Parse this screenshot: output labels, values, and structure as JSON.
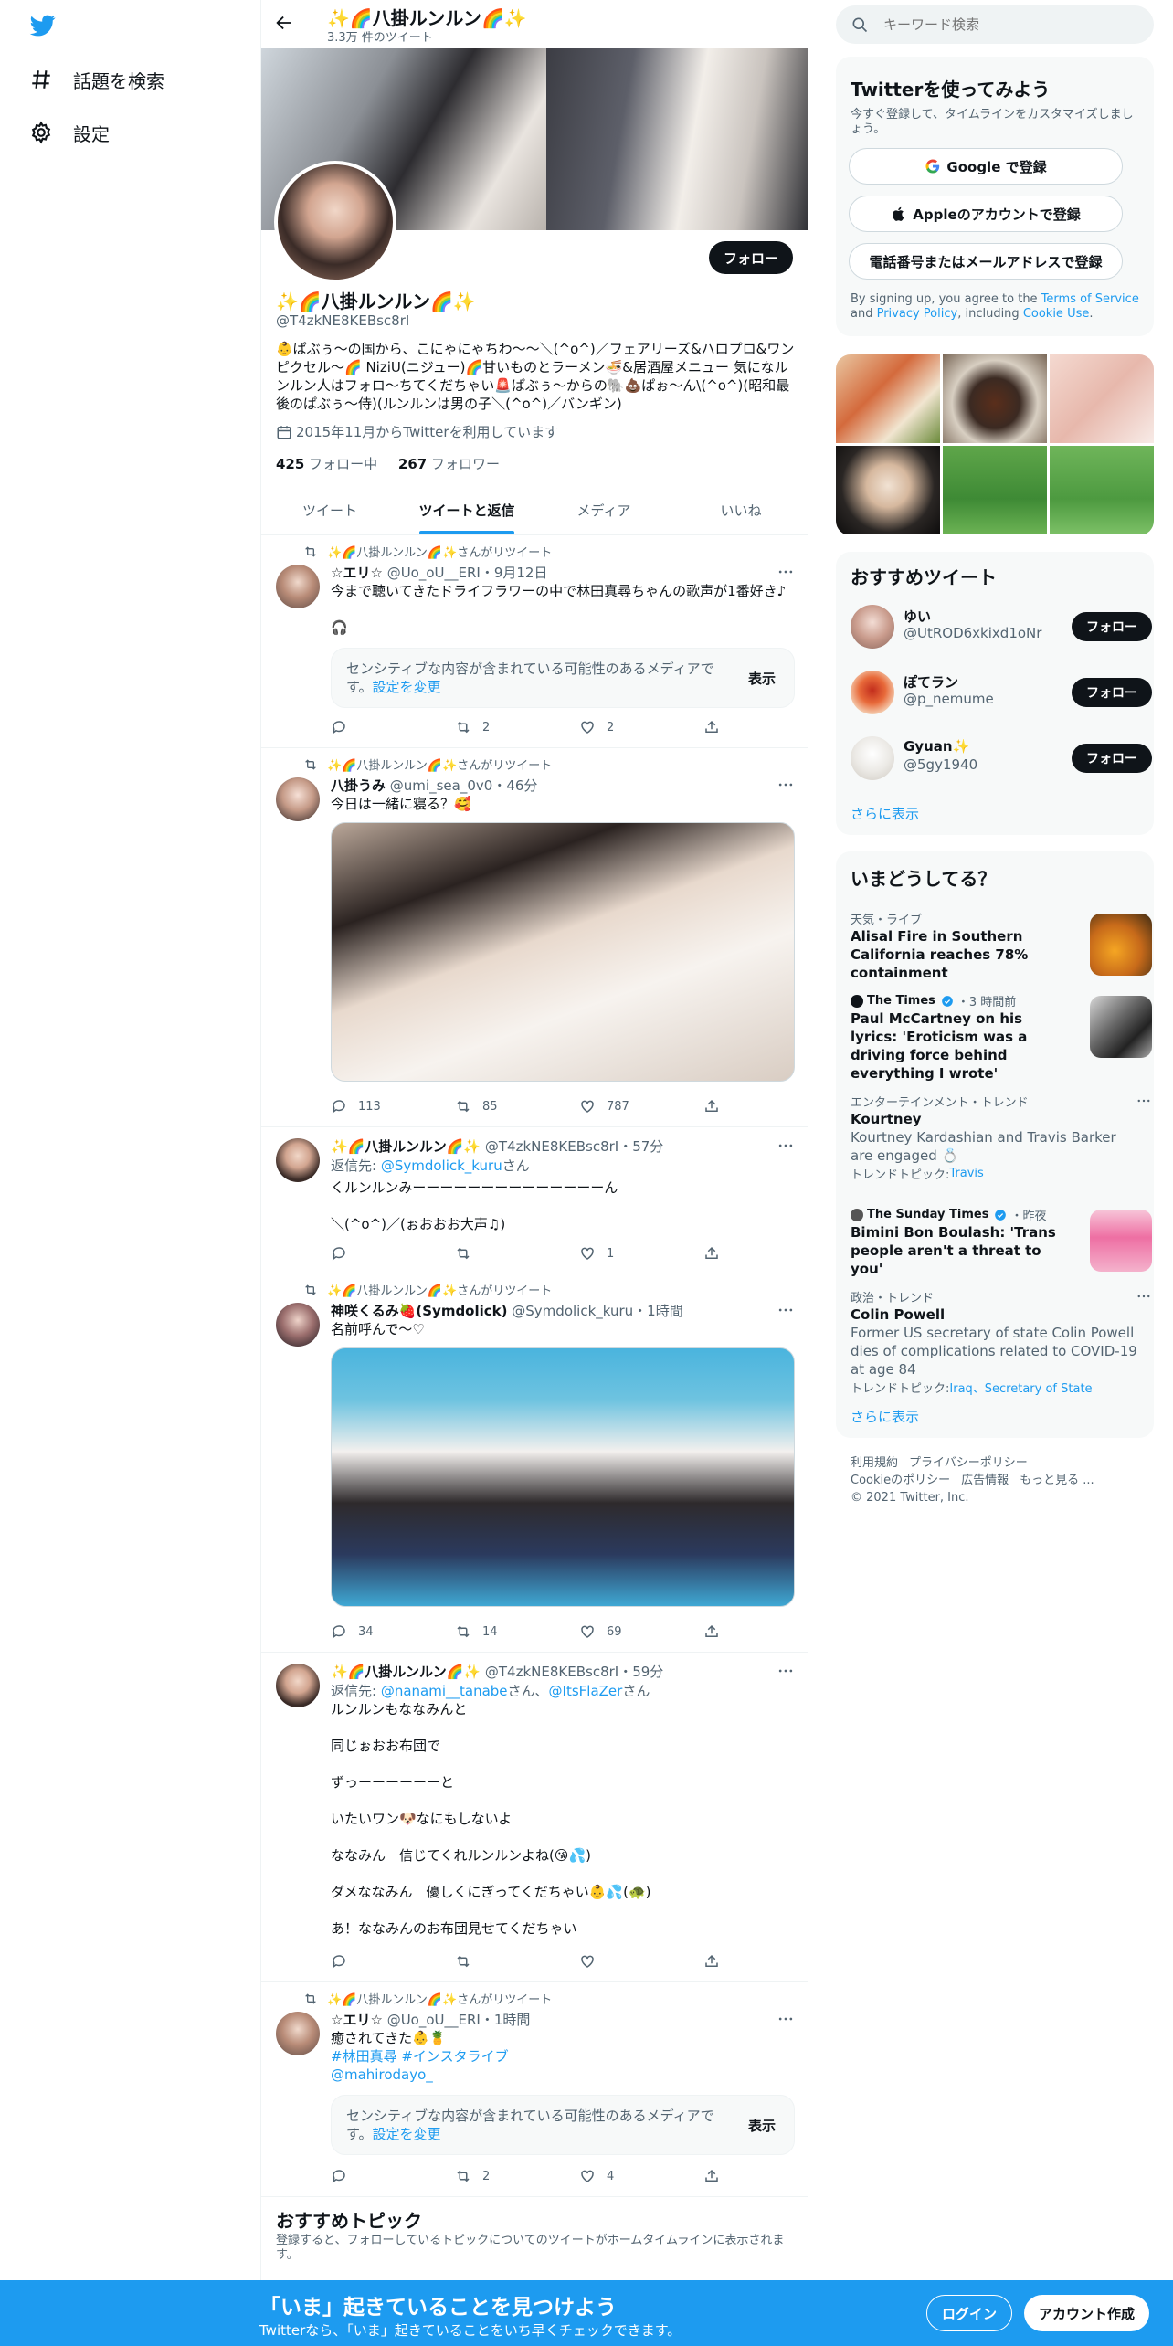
{
  "nav": {
    "explore_label": "話題を検索",
    "settings_label": "設定"
  },
  "header": {
    "name": "✨🌈八掛ルンルン🌈✨",
    "tweet_count": "3.3万 件のツイート"
  },
  "profile": {
    "follow_label": "フォロー",
    "name": "✨🌈八掛ルンルン🌈✨",
    "handle": "@T4zkNE8KEBsc8rI",
    "bio": "👶ぱぶぅ〜の国から、こにゃにゃちわ〜〜＼(^o^)／フェアリーズ&ハロプロ&ワンピクセル〜🌈 NiziU(ニジュー)🌈甘いものとラーメン🍜&居酒屋メニュー 気になルンルン人はフォロ〜ちてくだちゃい🚨ぱぶぅ〜からの🐘💩ぱぉ〜ん\\(^o^)(昭和最後のぱぶぅ〜侍)(ルンルンは男の子＼(^o^)／バンギン)",
    "joined": "2015年11月からTwitterを利用しています",
    "following_count": "425",
    "following_label": "フォロー中",
    "followers_count": "267",
    "followers_label": "フォロワー"
  },
  "tabs": [
    "ツイート",
    "ツイートと返信",
    "メディア",
    "いいね"
  ],
  "tweets": [
    {
      "rt": "✨🌈八掛ルンルン🌈✨さんがリツイート",
      "name": "☆エリ☆",
      "handle": "@Uo_oU__ERI",
      "time": "・9月12日",
      "lines": [
        "今まで聴いてきたドライフラワーの中で林田真尋ちゃんの歌声が1番好き♪",
        "",
        "🎧"
      ],
      "sensitive": "センシティブな内容が含まれている可能性のあるメディアです。",
      "sensitive_link": "設定を変更",
      "show": "表示",
      "reply": "",
      "retweet": "2",
      "like": "2"
    },
    {
      "rt": "✨🌈八掛ルンルン🌈✨さんがリツイート",
      "name": "八掛うみ",
      "handle": "@umi_sea_0v0",
      "time": "・46分",
      "lines": [
        "今日は一緒に寝る？🥰"
      ],
      "reply": "113",
      "retweet": "85",
      "like": "787"
    },
    {
      "name": "✨🌈八掛ルンルン🌈✨",
      "handle": "@T4zkNE8KEBsc8rI",
      "time": "・57分",
      "reply_to_label": "返信先: ",
      "reply_to": "@Symdolick_kuru",
      "reply_to_suffix": "さん",
      "lines": [
        "くルンルンみーーーーーーーーーーーーーーん",
        "",
        "＼(^o^)／(ぉおおお大声♫)"
      ],
      "reply": "",
      "retweet": "",
      "like": "1"
    },
    {
      "rt": "✨🌈八掛ルンルン🌈✨さんがリツイート",
      "name": "神咲くるみ🍓(Symdolick)",
      "handle": "@Symdolick_kuru",
      "time": "・1時間",
      "lines": [
        "名前呼んで〜♡"
      ],
      "reply": "34",
      "retweet": "14",
      "like": "69"
    },
    {
      "name": "✨🌈八掛ルンルン🌈✨",
      "handle": "@T4zkNE8KEBsc8rI",
      "time": "・59分",
      "reply_to_label": "返信先: ",
      "reply_to": "@nanami__tanabe",
      "reply_to_mid": "さん、",
      "reply_to2": "@ItsFlaZer",
      "reply_to_suffix": "さん",
      "lines": [
        "ルンルンもななみんと",
        "",
        "同じぉおお布団で",
        "",
        "ずっーーーーーーと",
        "",
        "いたいワン🐶なにもしないよ",
        "",
        "ななみん　信じてくれルンルンよね(😘💦)",
        "",
        "ダメななみん　優しくにぎってくだちゃい👶💦(🐢)",
        "",
        "あ！ななみんのお布団見せてくだちゃい"
      ],
      "reply": "",
      "retweet": "",
      "like": ""
    },
    {
      "rt": "✨🌈八掛ルンルン🌈✨さんがリツイート",
      "name": "☆エリ☆",
      "handle": "@Uo_oU__ERI",
      "time": "・1時間",
      "lines": [
        "癒されてきた👶🍍"
      ],
      "hashtags": "#林田真尋 #インスタライブ",
      "mention": "@mahirodayo_",
      "sensitive": "センシティブな内容が含まれている可能性のあるメディアです。",
      "sensitive_link": "設定を変更",
      "show": "表示",
      "reply": "",
      "retweet": "2",
      "like": "4"
    }
  ],
  "rec_topics": {
    "title": "おすすめトピック",
    "subtitle": "登録すると、フォローしているトピックについてのツイートがホームタイムラインに表示されます。"
  },
  "search": {
    "placeholder": "キーワード検索"
  },
  "signup": {
    "title": "Twitterを使ってみよう",
    "subtitle": "今すぐ登録して、タイムラインをカスタマイズしましょう。",
    "google": "Google で登録",
    "apple": "Appleのアカウントで登録",
    "phone": "電話番号またはメールアドレスで登録",
    "terms_prefix": "By signing up, you agree to the ",
    "terms_tos": "Terms of Service",
    "terms_and": " and ",
    "terms_privacy": "Privacy Policy",
    "terms_including": ", including ",
    "terms_cookie": "Cookie Use",
    "terms_end": "."
  },
  "who_to_follow": {
    "title": "おすすめツイート",
    "users": [
      {
        "name": "ゆい",
        "handle": "@UtROD6xkixd1oNr",
        "button": "フォロー"
      },
      {
        "name": "ぽてラン",
        "handle": "@p_nemume",
        "button": "フォロー"
      },
      {
        "name": "Gyuan✨",
        "handle": "@5gy1940",
        "button": "フォロー"
      }
    ],
    "more": "さらに表示"
  },
  "trends": {
    "title": "いまどうしてる？",
    "items": [
      {
        "meta": "天気・ライブ",
        "title": "Alisal Fire in Southern California reaches 78% containment"
      },
      {
        "source": "The Times",
        "meta": "・3 時間前",
        "title": "Paul McCartney on his lyrics: 'Eroticism was a driving force behind everything I wrote'"
      },
      {
        "meta": "エンターテインメント・トレンド",
        "title": "Kourtney",
        "desc": "Kourtney Kardashian and Travis Barker are engaged 💍",
        "topic_label": "トレンドトピック: ",
        "topic": "Travis"
      },
      {
        "source": "The Sunday Times",
        "meta": "・昨夜",
        "title": "Bimini Bon Boulash: 'Trans people aren't a threat to you'"
      },
      {
        "meta": "政治・トレンド",
        "title": "Colin Powell",
        "desc": "Former US secretary of state Colin Powell dies of complications related to COVID-19 at age 84",
        "topic_label": "トレンドトピック: ",
        "topic": "Iraq、Secretary of State"
      }
    ],
    "more": "さらに表示"
  },
  "footer": {
    "terms": "利用規約",
    "privacy": "プライバシーポリシー",
    "cookie": "Cookieのポリシー",
    "ads": "広告情報",
    "more": "もっと見る ...",
    "copyright": "© 2021 Twitter, Inc."
  },
  "bottom_bar": {
    "title": "「いま」起きていることを見つけよう",
    "subtitle": "Twitterなら、「いま」起きていることをいち早くチェックできます。",
    "login": "ログイン",
    "signup": "アカウント作成"
  },
  "colors": {
    "accent": "#1d9bf0",
    "text": "#0f1419",
    "muted": "#536471"
  }
}
